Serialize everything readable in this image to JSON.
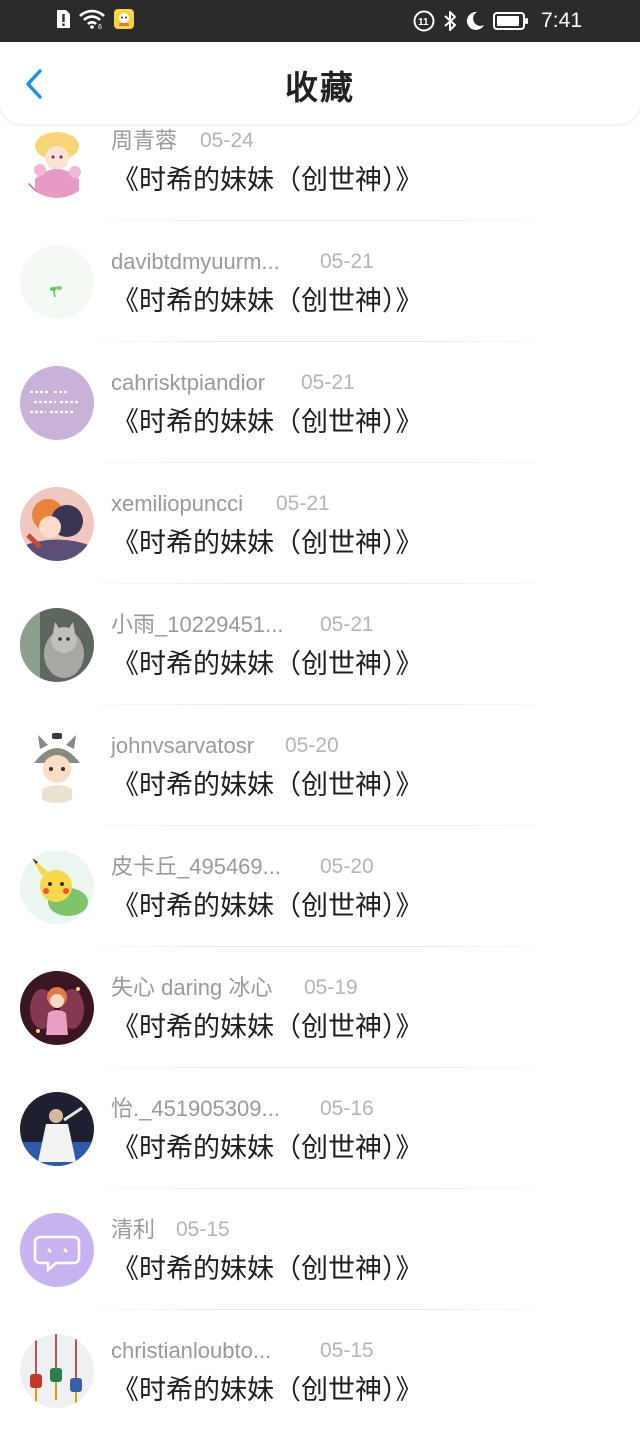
{
  "status_bar": {
    "time": "7:41",
    "icons_left": [
      "alert-icon",
      "wifi-icon",
      "app-notification-icon"
    ],
    "icons_right": [
      "hd-icon",
      "bluetooth-icon",
      "moon-icon",
      "battery-icon"
    ]
  },
  "header": {
    "title": "收藏",
    "back_icon": "chevron-left-icon",
    "accent_color": "#1e8ee6"
  },
  "favorites": [
    {
      "username": "周青蓉",
      "date": "05-24",
      "title": "《时希的妹妹（创世神）》",
      "avatar": "anime-girl-avatar"
    },
    {
      "username": "davibtdmyuurm...",
      "date": "05-21",
      "title": "《时希的妹妹（创世神）》",
      "avatar": "green-sprout-avatar"
    },
    {
      "username": "cahrisktpiandior",
      "date": "05-21",
      "title": "《时希的妹妹（创世神）》",
      "avatar": "purple-text-avatar"
    },
    {
      "username": "xemiliopuncci",
      "date": "05-21",
      "title": "《时希的妹妹（创世神）》",
      "avatar": "anime-couple-avatar"
    },
    {
      "username": "小雨_10229451...",
      "date": "05-21",
      "title": "《时希的妹妹（创世神）》",
      "avatar": "cat-avatar"
    },
    {
      "username": "johnvsarvatosr",
      "date": "05-20",
      "title": "《时希的妹妹（创世神）》",
      "avatar": "totoro-kid-avatar"
    },
    {
      "username": "皮卡丘_495469...",
      "date": "05-20",
      "title": "《时希的妹妹（创世神）》",
      "avatar": "pikachu-avatar"
    },
    {
      "username": "失心 daring 冰心",
      "date": "05-19",
      "title": "《时希的妹妹（创世神）》",
      "avatar": "fairy-avatar"
    },
    {
      "username": "怡._451905309...",
      "date": "05-16",
      "title": "《时希的妹妹（创世神）》",
      "avatar": "dark-photo-avatar"
    },
    {
      "username": "清利",
      "date": "05-15",
      "title": "《时希的妹妹（创世神）》",
      "avatar": "default-chat-avatar"
    },
    {
      "username": "christianloubto...",
      "date": "05-15",
      "title": "《时希的妹妹（创世神）》",
      "avatar": "ornaments-avatar"
    }
  ]
}
